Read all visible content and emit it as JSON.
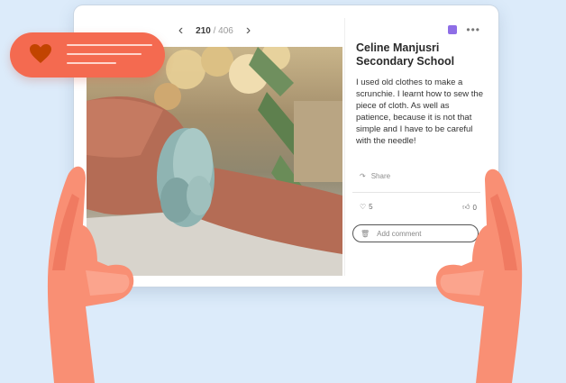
{
  "pager": {
    "current": "210",
    "total": "/ 406"
  },
  "post": {
    "school": "Celine Manjusri Secondary School",
    "text": "I used old clothes to make a scrunchie. I learnt how to sew the piece of cloth. As well as patience, because it is not that simple and I have to be careful with the needle!",
    "share_label": "Share",
    "likes": "5",
    "thumbs": "0"
  },
  "comment": {
    "placeholder": "Add comment"
  },
  "colors": {
    "background": "#dcebfa",
    "notification": "#f46a50",
    "hands": "#f98f74",
    "accent": "#8e6ee6"
  }
}
